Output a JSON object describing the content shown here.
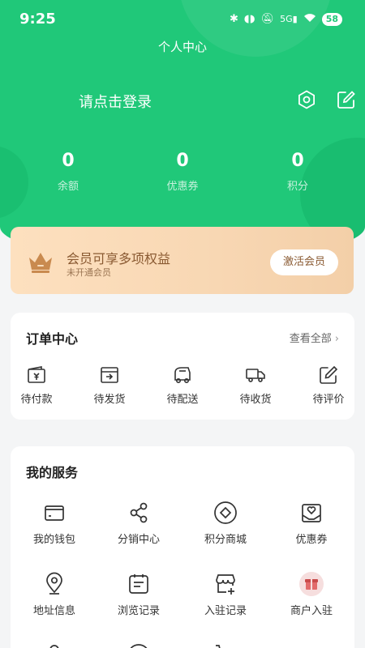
{
  "status_bar": {
    "time": "9:25",
    "battery": "58"
  },
  "header": {
    "title": "个人中心",
    "login_text": "请点击登录",
    "stats": [
      {
        "value": "0",
        "label": "余额"
      },
      {
        "value": "0",
        "label": "优惠券"
      },
      {
        "value": "0",
        "label": "积分"
      }
    ]
  },
  "vip": {
    "title": "会员可享多项权益",
    "subtitle": "未开通会员",
    "button": "激活会员"
  },
  "orders": {
    "title": "订单中心",
    "see_all": "查看全部",
    "items": [
      {
        "label": "待付款",
        "icon": "wallet-yuan-icon"
      },
      {
        "label": "待发货",
        "icon": "box-out-icon"
      },
      {
        "label": "待配送",
        "icon": "delivery-van-icon"
      },
      {
        "label": "待收货",
        "icon": "truck-icon"
      },
      {
        "label": "待评价",
        "icon": "pencil-edit-icon"
      }
    ]
  },
  "services": {
    "title": "我的服务",
    "items": [
      {
        "label": "我的钱包",
        "icon": "wallet-icon"
      },
      {
        "label": "分销中心",
        "icon": "share-icon"
      },
      {
        "label": "积分商城",
        "icon": "diamond-circle-icon"
      },
      {
        "label": "优惠券",
        "icon": "coupon-heart-icon"
      },
      {
        "label": "地址信息",
        "icon": "location-pin-icon"
      },
      {
        "label": "浏览记录",
        "icon": "history-list-icon"
      },
      {
        "label": "入驻记录",
        "icon": "store-add-icon"
      },
      {
        "label": "商户入驻",
        "icon": "merchant-gift-icon"
      }
    ]
  },
  "colors": {
    "primary": "#20c879",
    "vip_text": "#8a5a32",
    "page_bg": "#f4f5f6"
  }
}
